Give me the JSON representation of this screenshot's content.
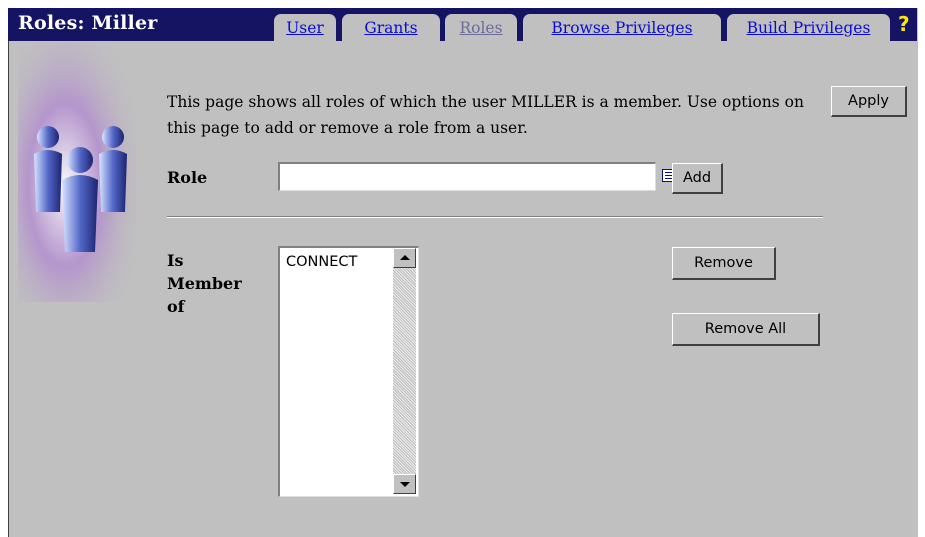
{
  "header": {
    "title": "Roles: Miller",
    "tabs": [
      {
        "label": "User",
        "active": false
      },
      {
        "label": "Grants",
        "active": false
      },
      {
        "label": "Roles",
        "active": true
      },
      {
        "label": "Browse Privileges",
        "active": false
      },
      {
        "label": "Build Privileges",
        "active": false
      }
    ],
    "help_label": "?"
  },
  "main": {
    "description": "This page shows all roles of which the user MILLER is a member. Use options on this page to add or remove a role from a user.",
    "apply_label": "Apply",
    "role": {
      "label": "Role",
      "value": "",
      "lookup_icon": "list-icon",
      "add_label": "Add"
    },
    "membership": {
      "label_line1": "Is",
      "label_line2": "Member",
      "label_line3": "of",
      "items": [
        "CONNECT"
      ],
      "remove_label": "Remove",
      "remove_all_label": "Remove All"
    }
  },
  "colors": {
    "header_bg": "#141462",
    "panel_bg": "#c0c0c0",
    "link": "#0b0bd0",
    "active_tab": "#6b6b9a",
    "help": "#ffe600"
  }
}
